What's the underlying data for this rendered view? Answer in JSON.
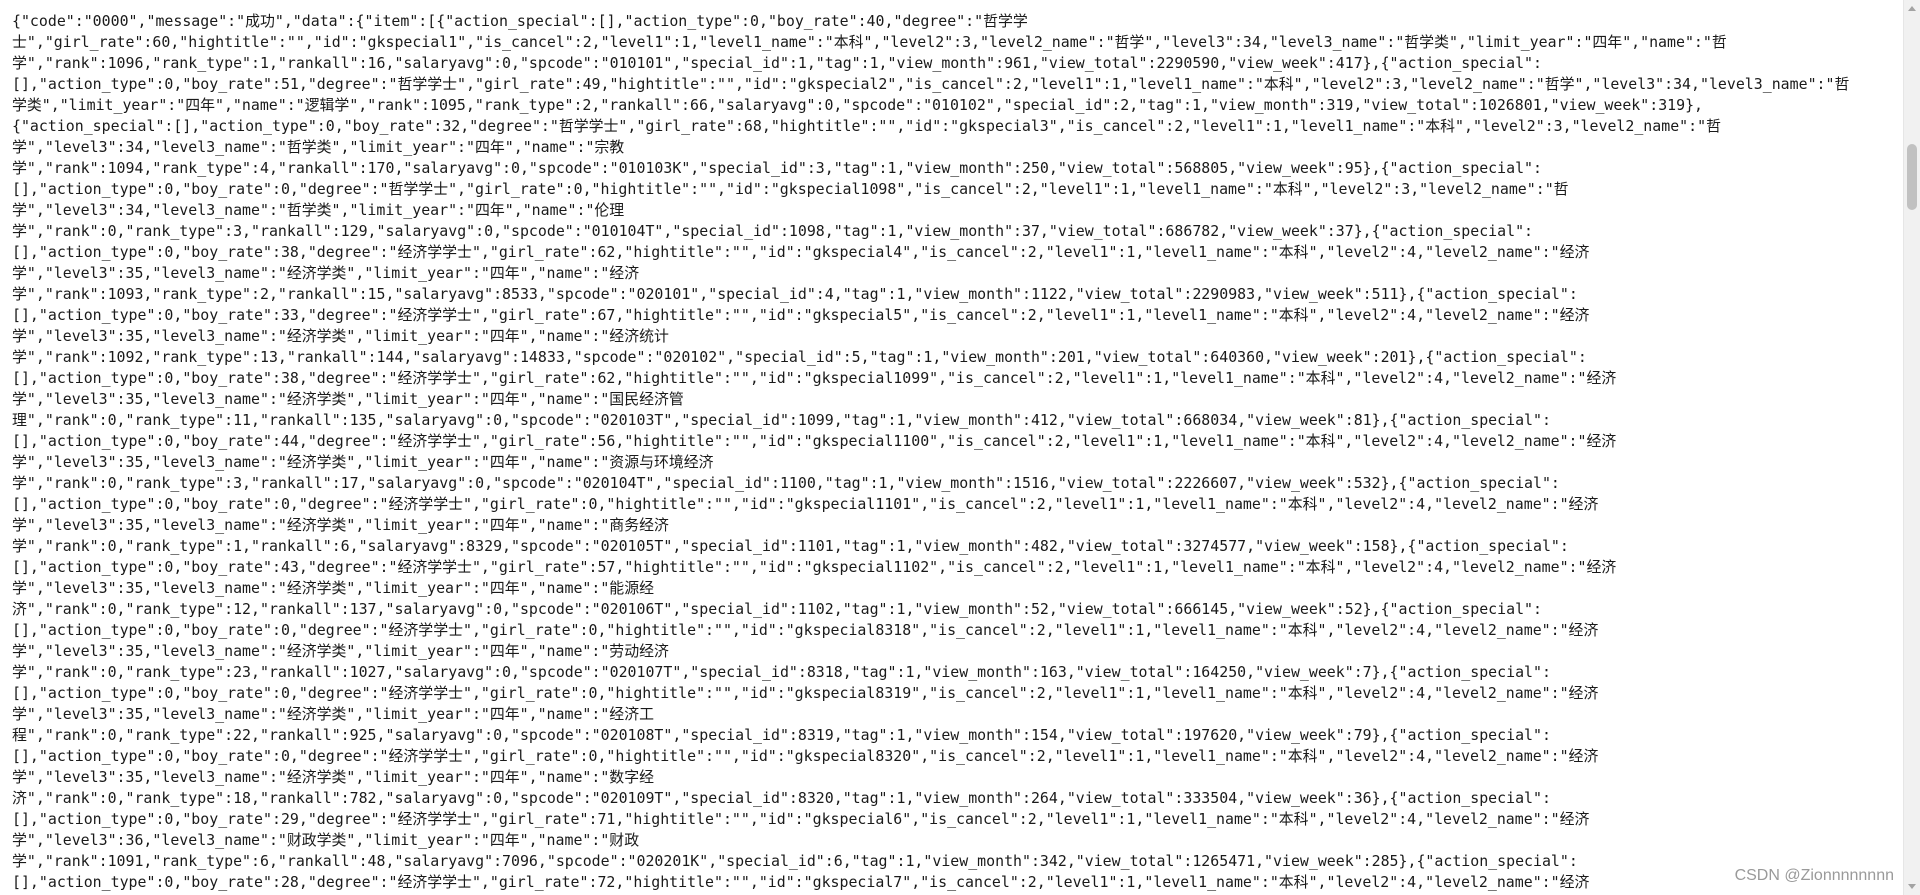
{
  "json_view": {
    "lines": [
      "{\"code\":\"0000\",\"message\":\"成功\",\"data\":{\"item\":[{\"action_special\":[],\"action_type\":0,\"boy_rate\":40,\"degree\":\"哲学学",
      "士\",\"girl_rate\":60,\"hightitle\":\"\",\"id\":\"gkspecial1\",\"is_cancel\":2,\"level1\":1,\"level1_name\":\"本科\",\"level2\":3,\"level2_name\":\"哲学\",\"level3\":34,\"level3_name\":\"哲学类\",\"limit_year\":\"四年\",\"name\":\"哲",
      "学\",\"rank\":1096,\"rank_type\":1,\"rankall\":16,\"salaryavg\":0,\"spcode\":\"010101\",\"special_id\":1,\"tag\":1,\"view_month\":961,\"view_total\":2290590,\"view_week\":417},{\"action_special\":",
      "[],\"action_type\":0,\"boy_rate\":51,\"degree\":\"哲学学士\",\"girl_rate\":49,\"hightitle\":\"\",\"id\":\"gkspecial2\",\"is_cancel\":2,\"level1\":1,\"level1_name\":\"本科\",\"level2\":3,\"level2_name\":\"哲学\",\"level3\":34,\"level3_name\":\"哲",
      "学类\",\"limit_year\":\"四年\",\"name\":\"逻辑学\",\"rank\":1095,\"rank_type\":2,\"rankall\":66,\"salaryavg\":0,\"spcode\":\"010102\",\"special_id\":2,\"tag\":1,\"view_month\":319,\"view_total\":1026801,\"view_week\":319},",
      "{\"action_special\":[],\"action_type\":0,\"boy_rate\":32,\"degree\":\"哲学学士\",\"girl_rate\":68,\"hightitle\":\"\",\"id\":\"gkspecial3\",\"is_cancel\":2,\"level1\":1,\"level1_name\":\"本科\",\"level2\":3,\"level2_name\":\"哲",
      "学\",\"level3\":34,\"level3_name\":\"哲学类\",\"limit_year\":\"四年\",\"name\":\"宗教",
      "学\",\"rank\":1094,\"rank_type\":4,\"rankall\":170,\"salaryavg\":0,\"spcode\":\"010103K\",\"special_id\":3,\"tag\":1,\"view_month\":250,\"view_total\":568805,\"view_week\":95},{\"action_special\":",
      "[],\"action_type\":0,\"boy_rate\":0,\"degree\":\"哲学学士\",\"girl_rate\":0,\"hightitle\":\"\",\"id\":\"gkspecial1098\",\"is_cancel\":2,\"level1\":1,\"level1_name\":\"本科\",\"level2\":3,\"level2_name\":\"哲",
      "学\",\"level3\":34,\"level3_name\":\"哲学类\",\"limit_year\":\"四年\",\"name\":\"伦理",
      "学\",\"rank\":0,\"rank_type\":3,\"rankall\":129,\"salaryavg\":0,\"spcode\":\"010104T\",\"special_id\":1098,\"tag\":1,\"view_month\":37,\"view_total\":686782,\"view_week\":37},{\"action_special\":",
      "[],\"action_type\":0,\"boy_rate\":38,\"degree\":\"经济学学士\",\"girl_rate\":62,\"hightitle\":\"\",\"id\":\"gkspecial4\",\"is_cancel\":2,\"level1\":1,\"level1_name\":\"本科\",\"level2\":4,\"level2_name\":\"经济",
      "学\",\"level3\":35,\"level3_name\":\"经济学类\",\"limit_year\":\"四年\",\"name\":\"经济",
      "学\",\"rank\":1093,\"rank_type\":2,\"rankall\":15,\"salaryavg\":8533,\"spcode\":\"020101\",\"special_id\":4,\"tag\":1,\"view_month\":1122,\"view_total\":2290983,\"view_week\":511},{\"action_special\":",
      "[],\"action_type\":0,\"boy_rate\":33,\"degree\":\"经济学学士\",\"girl_rate\":67,\"hightitle\":\"\",\"id\":\"gkspecial5\",\"is_cancel\":2,\"level1\":1,\"level1_name\":\"本科\",\"level2\":4,\"level2_name\":\"经济",
      "学\",\"level3\":35,\"level3_name\":\"经济学类\",\"limit_year\":\"四年\",\"name\":\"经济统计",
      "学\",\"rank\":1092,\"rank_type\":13,\"rankall\":144,\"salaryavg\":14833,\"spcode\":\"020102\",\"special_id\":5,\"tag\":1,\"view_month\":201,\"view_total\":640360,\"view_week\":201},{\"action_special\":",
      "[],\"action_type\":0,\"boy_rate\":38,\"degree\":\"经济学学士\",\"girl_rate\":62,\"hightitle\":\"\",\"id\":\"gkspecial1099\",\"is_cancel\":2,\"level1\":1,\"level1_name\":\"本科\",\"level2\":4,\"level2_name\":\"经济",
      "学\",\"level3\":35,\"level3_name\":\"经济学类\",\"limit_year\":\"四年\",\"name\":\"国民经济管",
      "理\",\"rank\":0,\"rank_type\":11,\"rankall\":135,\"salaryavg\":0,\"spcode\":\"020103T\",\"special_id\":1099,\"tag\":1,\"view_month\":412,\"view_total\":668034,\"view_week\":81},{\"action_special\":",
      "[],\"action_type\":0,\"boy_rate\":44,\"degree\":\"经济学学士\",\"girl_rate\":56,\"hightitle\":\"\",\"id\":\"gkspecial1100\",\"is_cancel\":2,\"level1\":1,\"level1_name\":\"本科\",\"level2\":4,\"level2_name\":\"经济",
      "学\",\"level3\":35,\"level3_name\":\"经济学类\",\"limit_year\":\"四年\",\"name\":\"资源与环境经济",
      "学\",\"rank\":0,\"rank_type\":3,\"rankall\":17,\"salaryavg\":0,\"spcode\":\"020104T\",\"special_id\":1100,\"tag\":1,\"view_month\":1516,\"view_total\":2226607,\"view_week\":532},{\"action_special\":",
      "[],\"action_type\":0,\"boy_rate\":0,\"degree\":\"经济学学士\",\"girl_rate\":0,\"hightitle\":\"\",\"id\":\"gkspecial1101\",\"is_cancel\":2,\"level1\":1,\"level1_name\":\"本科\",\"level2\":4,\"level2_name\":\"经济",
      "学\",\"level3\":35,\"level3_name\":\"经济学类\",\"limit_year\":\"四年\",\"name\":\"商务经济",
      "学\",\"rank\":0,\"rank_type\":1,\"rankall\":6,\"salaryavg\":8329,\"spcode\":\"020105T\",\"special_id\":1101,\"tag\":1,\"view_month\":482,\"view_total\":3274577,\"view_week\":158},{\"action_special\":",
      "[],\"action_type\":0,\"boy_rate\":43,\"degree\":\"经济学学士\",\"girl_rate\":57,\"hightitle\":\"\",\"id\":\"gkspecial1102\",\"is_cancel\":2,\"level1\":1,\"level1_name\":\"本科\",\"level2\":4,\"level2_name\":\"经济",
      "学\",\"level3\":35,\"level3_name\":\"经济学类\",\"limit_year\":\"四年\",\"name\":\"能源经",
      "济\",\"rank\":0,\"rank_type\":12,\"rankall\":137,\"salaryavg\":0,\"spcode\":\"020106T\",\"special_id\":1102,\"tag\":1,\"view_month\":52,\"view_total\":666145,\"view_week\":52},{\"action_special\":",
      "[],\"action_type\":0,\"boy_rate\":0,\"degree\":\"经济学学士\",\"girl_rate\":0,\"hightitle\":\"\",\"id\":\"gkspecial8318\",\"is_cancel\":2,\"level1\":1,\"level1_name\":\"本科\",\"level2\":4,\"level2_name\":\"经济",
      "学\",\"level3\":35,\"level3_name\":\"经济学类\",\"limit_year\":\"四年\",\"name\":\"劳动经济",
      "学\",\"rank\":0,\"rank_type\":23,\"rankall\":1027,\"salaryavg\":0,\"spcode\":\"020107T\",\"special_id\":8318,\"tag\":1,\"view_month\":163,\"view_total\":164250,\"view_week\":7},{\"action_special\":",
      "[],\"action_type\":0,\"boy_rate\":0,\"degree\":\"经济学学士\",\"girl_rate\":0,\"hightitle\":\"\",\"id\":\"gkspecial8319\",\"is_cancel\":2,\"level1\":1,\"level1_name\":\"本科\",\"level2\":4,\"level2_name\":\"经济",
      "学\",\"level3\":35,\"level3_name\":\"经济学类\",\"limit_year\":\"四年\",\"name\":\"经济工",
      "程\",\"rank\":0,\"rank_type\":22,\"rankall\":925,\"salaryavg\":0,\"spcode\":\"020108T\",\"special_id\":8319,\"tag\":1,\"view_month\":154,\"view_total\":197620,\"view_week\":79},{\"action_special\":",
      "[],\"action_type\":0,\"boy_rate\":0,\"degree\":\"经济学学士\",\"girl_rate\":0,\"hightitle\":\"\",\"id\":\"gkspecial8320\",\"is_cancel\":2,\"level1\":1,\"level1_name\":\"本科\",\"level2\":4,\"level2_name\":\"经济",
      "学\",\"level3\":35,\"level3_name\":\"经济学类\",\"limit_year\":\"四年\",\"name\":\"数字经",
      "济\",\"rank\":0,\"rank_type\":18,\"rankall\":782,\"salaryavg\":0,\"spcode\":\"020109T\",\"special_id\":8320,\"tag\":1,\"view_month\":264,\"view_total\":333504,\"view_week\":36},{\"action_special\":",
      "[],\"action_type\":0,\"boy_rate\":29,\"degree\":\"经济学学士\",\"girl_rate\":71,\"hightitle\":\"\",\"id\":\"gkspecial6\",\"is_cancel\":2,\"level1\":1,\"level1_name\":\"本科\",\"level2\":4,\"level2_name\":\"经济",
      "学\",\"level3\":36,\"level3_name\":\"财政学类\",\"limit_year\":\"四年\",\"name\":\"财政",
      "学\",\"rank\":1091,\"rank_type\":6,\"rankall\":48,\"salaryavg\":7096,\"spcode\":\"020201K\",\"special_id\":6,\"tag\":1,\"view_month\":342,\"view_total\":1265471,\"view_week\":285},{\"action_special\":",
      "[],\"action_type\":0,\"boy_rate\":28,\"degree\":\"经济学学士\",\"girl_rate\":72,\"hightitle\":\"\",\"id\":\"gkspecial7\",\"is_cancel\":2,\"level1\":1,\"level1_name\":\"本科\",\"level2\":4,\"level2_name\":\"经济"
    ]
  },
  "scrollbar": {
    "position": 0.16
  },
  "watermark": {
    "text": "CSDN @Zionnnnnnnn"
  }
}
